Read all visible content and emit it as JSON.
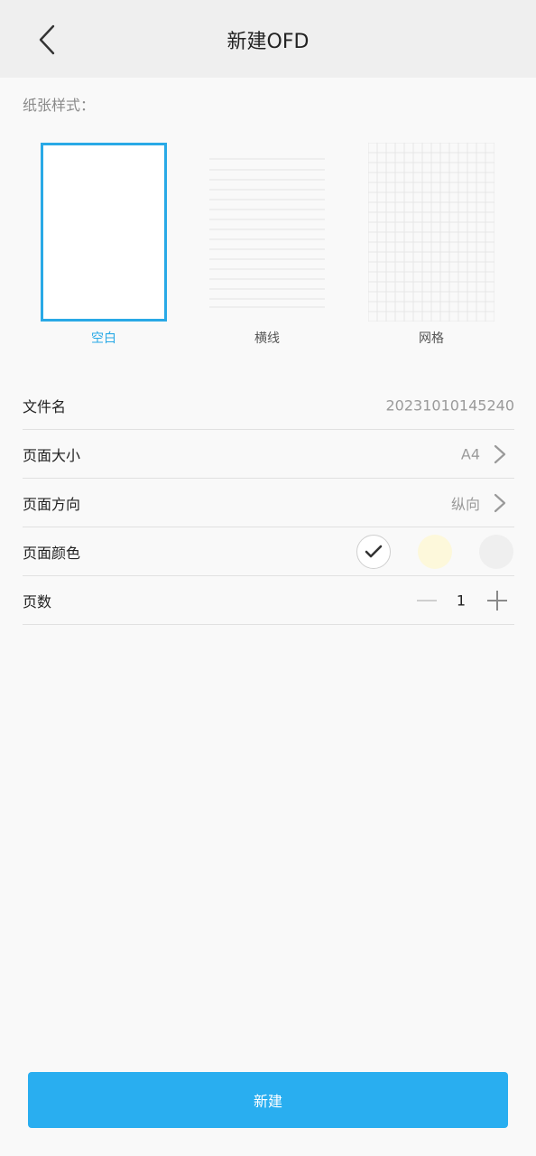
{
  "header": {
    "title": "新建OFD"
  },
  "paper_style": {
    "label": "纸张样式：",
    "options": [
      {
        "label": "空白",
        "selected": true
      },
      {
        "label": "横线",
        "selected": false
      },
      {
        "label": "网格",
        "selected": false
      }
    ]
  },
  "form": {
    "filename": {
      "label": "文件名",
      "value": "20231010145240"
    },
    "page_size": {
      "label": "页面大小",
      "value": "A4"
    },
    "orientation": {
      "label": "页面方向",
      "value": "纵向"
    },
    "page_color": {
      "label": "页面颜色",
      "swatches": [
        {
          "color": "#ffffff",
          "selected": true
        },
        {
          "color": "#fdf8db",
          "selected": false
        },
        {
          "color": "#efefef",
          "selected": false
        }
      ]
    },
    "page_count": {
      "label": "页数",
      "value": "1"
    }
  },
  "create_button": {
    "label": "新建"
  },
  "colors": {
    "accent": "#29aef0",
    "selected_border": "#29a9e6"
  }
}
